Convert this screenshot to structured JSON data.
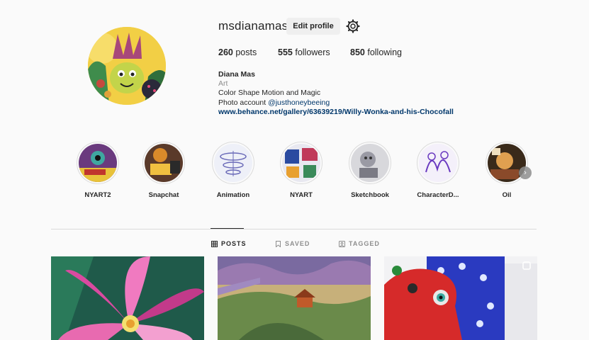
{
  "profile": {
    "username": "msdianamas",
    "edit_label": "Edit profile",
    "avatar_icon": "avatar-illustration",
    "settings_icon": "gear-icon"
  },
  "stats": {
    "posts_count": "260",
    "posts_label": "posts",
    "followers_count": "555",
    "followers_label": "followers",
    "following_count": "850",
    "following_label": "following"
  },
  "bio": {
    "name": "Diana Mas",
    "category": "Art",
    "line1": "Color Shape Motion and Magic",
    "line2_prefix": "Photo account ",
    "mention": "@justhoneybeeing",
    "link": "www.behance.net/gallery/63639219/Willy-Wonka-and-his-Chocofall"
  },
  "highlights": [
    {
      "label": "NYART2"
    },
    {
      "label": "Snapchat"
    },
    {
      "label": "Animation"
    },
    {
      "label": "NYART"
    },
    {
      "label": "Sketchbook"
    },
    {
      "label": "CharacterD..."
    },
    {
      "label": "Oil"
    }
  ],
  "highlights_next_icon": "chevron-right-icon",
  "tabs": [
    {
      "label": "POSTS",
      "icon": "grid-icon",
      "active": true
    },
    {
      "label": "SAVED",
      "icon": "bookmark-icon",
      "active": false
    },
    {
      "label": "TAGGED",
      "icon": "tag-icon",
      "active": false
    }
  ],
  "colors": {
    "background": "#fafafa",
    "text": "#262626",
    "secondary": "#8e8e8e",
    "link": "#00376b",
    "button": "#efefef",
    "border": "#dbdbdb"
  }
}
